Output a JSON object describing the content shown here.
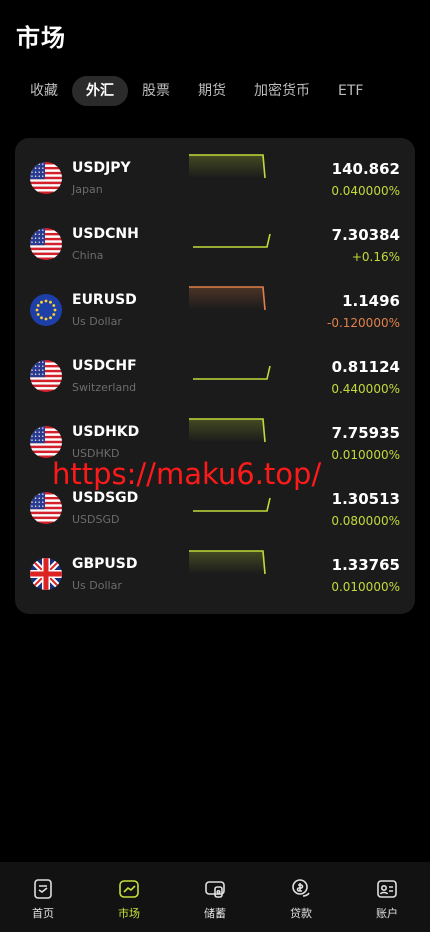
{
  "page_title": "市场",
  "tabs": [
    "收藏",
    "外汇",
    "股票",
    "期货",
    "加密货币",
    "ETF"
  ],
  "active_tab": 1,
  "colors": {
    "up": "#c3d93b",
    "down": "#e0804a",
    "accent": "#c8e03a"
  },
  "rows": [
    {
      "symbol": "USDJPY",
      "name": "Japan",
      "price": "140.862",
      "change": "0.040000%",
      "direction": "up",
      "flag": "jp-flag-icon",
      "trend": "flat-high-drop"
    },
    {
      "symbol": "USDCNH",
      "name": "China",
      "price": "7.30384",
      "change": "+0.16%",
      "direction": "up",
      "flag": "cn-flag-icon",
      "trend": "flat-low-rise"
    },
    {
      "symbol": "EURUSD",
      "name": "Us Dollar",
      "price": "1.1496",
      "change": "-0.120000%",
      "direction": "down",
      "flag": "eu-flag-icon",
      "trend": "flat-high-drop"
    },
    {
      "symbol": "USDCHF",
      "name": "Switzerland",
      "price": "0.81124",
      "change": "0.440000%",
      "direction": "up",
      "flag": "ch-flag-icon",
      "trend": "flat-low-rise"
    },
    {
      "symbol": "USDHKD",
      "name": "USDHKD",
      "price": "7.75935",
      "change": "0.010000%",
      "direction": "up",
      "flag": "hk-flag-icon",
      "trend": "flat-high-drop"
    },
    {
      "symbol": "USDSGD",
      "name": "USDSGD",
      "price": "1.30513",
      "change": "0.080000%",
      "direction": "up",
      "flag": "sg-flag-icon",
      "trend": "flat-low-rise"
    },
    {
      "symbol": "GBPUSD",
      "name": "Us Dollar",
      "price": "1.33765",
      "change": "0.010000%",
      "direction": "up",
      "flag": "gb-flag-icon",
      "trend": "flat-high-drop"
    }
  ],
  "watermark": "https://maku6.top/",
  "nav": [
    {
      "label": "首页",
      "icon": "home-doc-icon"
    },
    {
      "label": "市场",
      "icon": "market-chart-icon"
    },
    {
      "label": "储蓄",
      "icon": "savings-icon"
    },
    {
      "label": "贷款",
      "icon": "loan-coin-icon"
    },
    {
      "label": "账户",
      "icon": "account-card-icon"
    }
  ],
  "active_nav": 1
}
